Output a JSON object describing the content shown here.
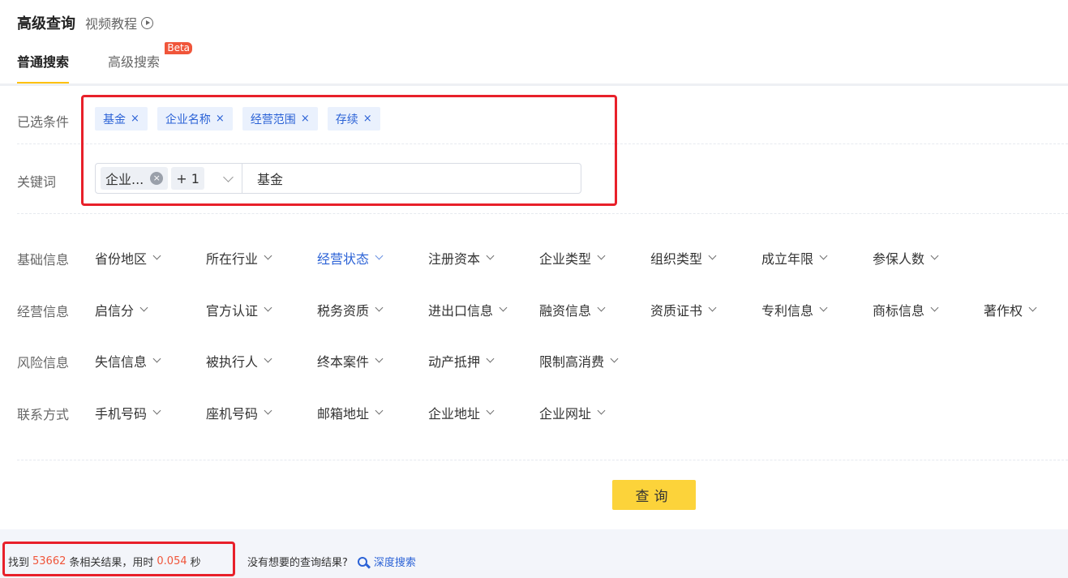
{
  "header": {
    "title": "高级查询",
    "video_link": "视频教程",
    "video_icon": "play-circle-icon"
  },
  "tabs": [
    {
      "label": "普通搜索",
      "active": true
    },
    {
      "label": "高级搜索",
      "badge": "Beta",
      "active": false
    }
  ],
  "selected": {
    "label": "已选条件",
    "chips": [
      "基金",
      "企业名称",
      "经营范围",
      "存续"
    ],
    "close_glyph": "×"
  },
  "keyword": {
    "label": "关键词",
    "field_tag": "企业...",
    "field_more": "+ 1",
    "value": "基金"
  },
  "filter_groups": [
    {
      "label": "基础信息",
      "items": [
        "省份地区",
        "所在行业",
        "经营状态",
        "注册资本",
        "企业类型",
        "组织类型",
        "成立年限",
        "参保人数"
      ],
      "active_item": "经营状态"
    },
    {
      "label": "经营信息",
      "items": [
        "启信分",
        "官方认证",
        "税务资质",
        "进出口信息",
        "融资信息",
        "资质证书",
        "专利信息",
        "商标信息",
        "著作权"
      ]
    },
    {
      "label": "风险信息",
      "items": [
        "失信信息",
        "被执行人",
        "终本案件",
        "动产抵押",
        "限制高消费"
      ]
    },
    {
      "label": "联系方式",
      "items": [
        "手机号码",
        "座机号码",
        "邮箱地址",
        "企业地址",
        "企业网址"
      ]
    }
  ],
  "query_button": "查询",
  "result": {
    "prefix": "找到",
    "count": "53662",
    "middle": "条相关结果，用时",
    "time": "0.054",
    "suffix": "秒",
    "help_text": "没有想要的查询结果?",
    "deep_search": "深度搜索"
  },
  "colors": {
    "accent": "#ffc107",
    "link": "#2b62d6",
    "highlight_number": "#f0553a",
    "annotation_red": "#e8202a"
  }
}
